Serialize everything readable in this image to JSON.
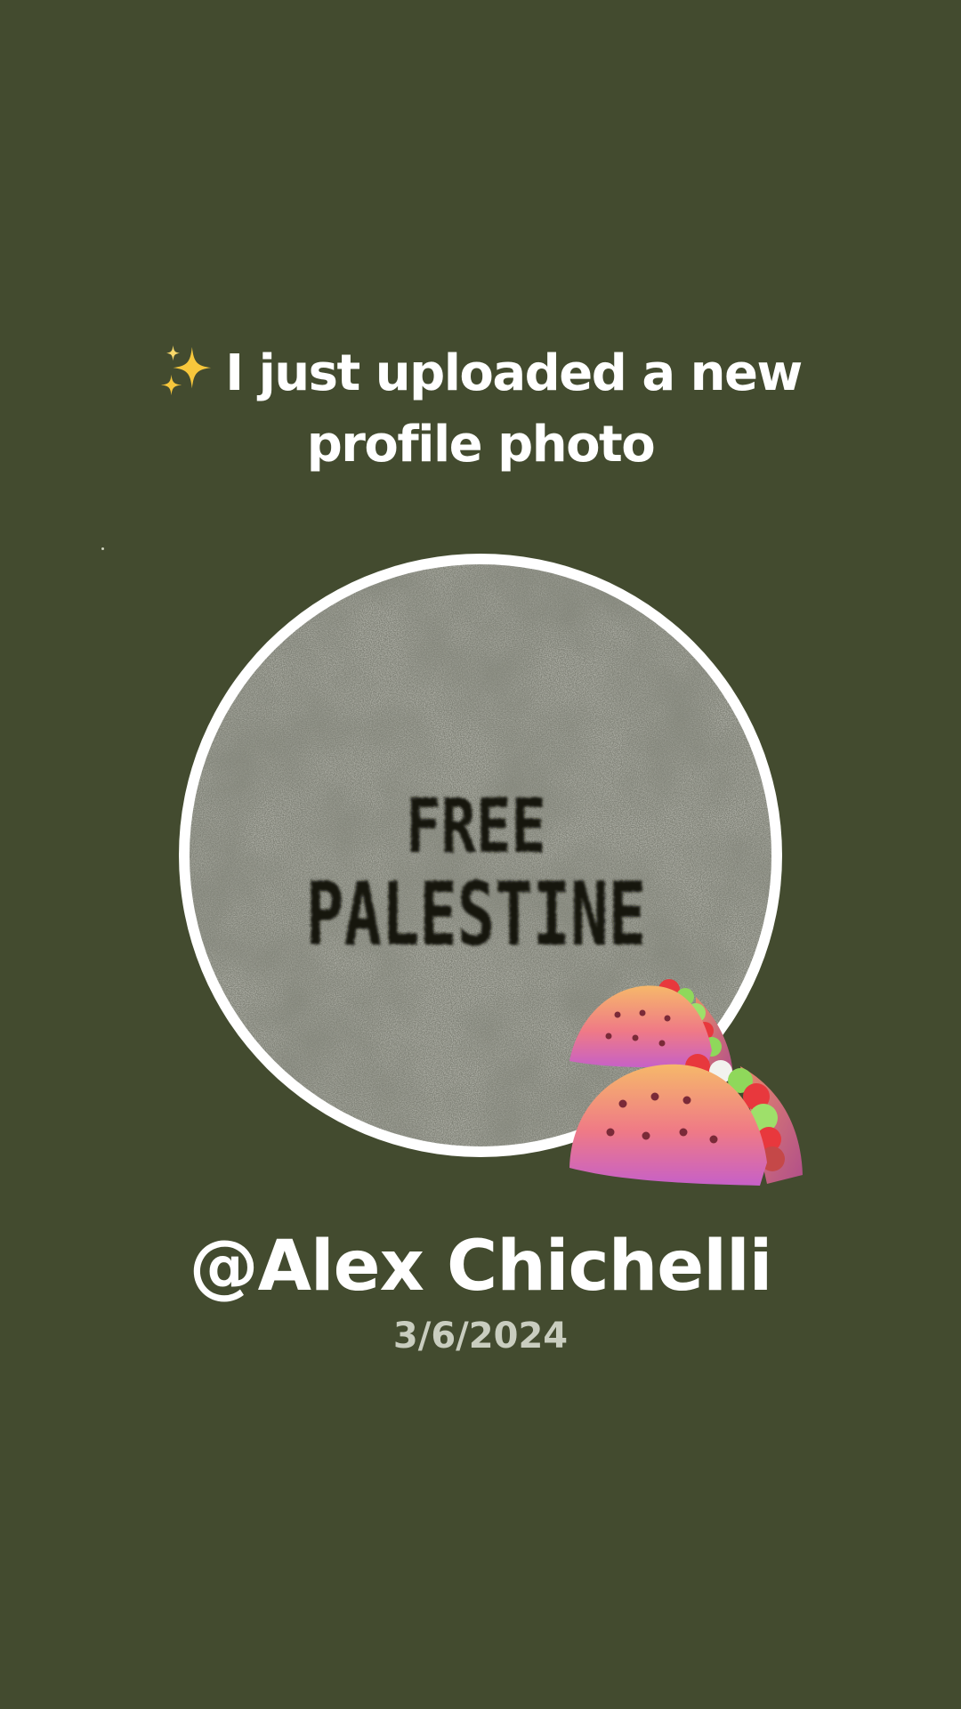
{
  "post": {
    "headline_line1": "I just uploaded a new",
    "headline_line2": "profile photo",
    "headline_icon": "sparkles-icon",
    "profile_photo_text_line1": "FREE",
    "profile_photo_text_line2": "PALESTINE",
    "sticker_icon": "taco-icon",
    "username": "@Alex Chichelli",
    "date": "3/6/2024"
  },
  "colors": {
    "background": "#434b2f",
    "text": "#ffffff",
    "date_text": "#c9cdbf",
    "ring": "#ffffff"
  }
}
